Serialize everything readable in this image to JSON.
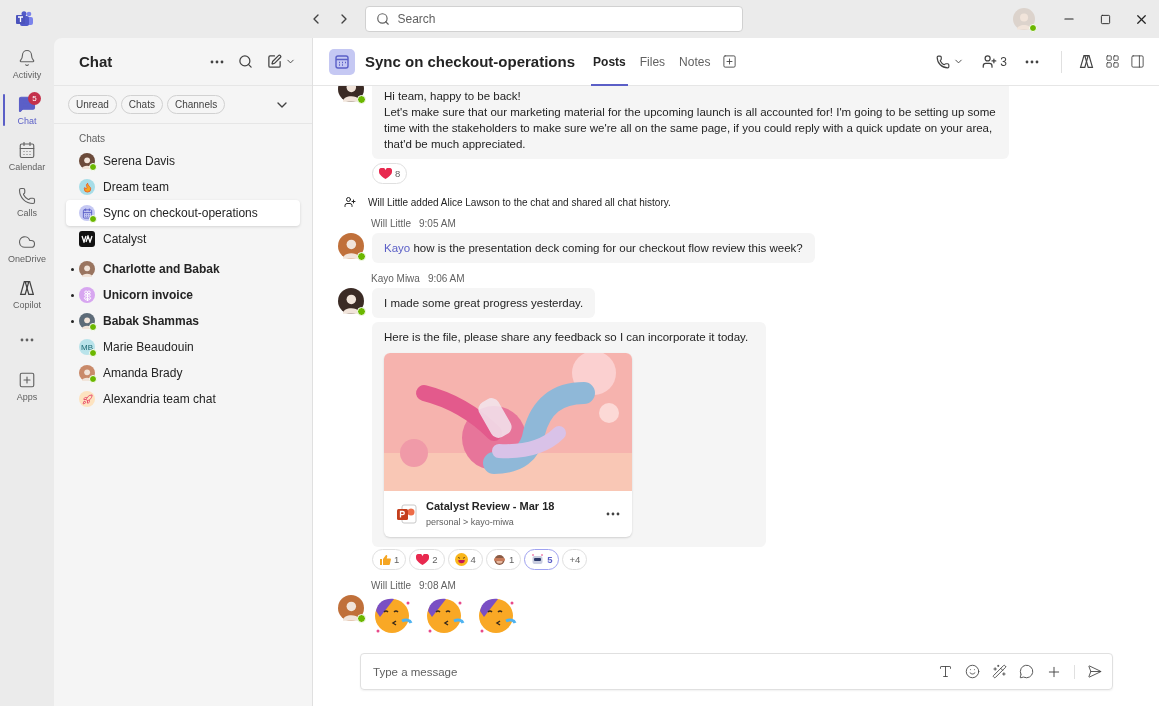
{
  "titlebar": {
    "search_placeholder": "Search"
  },
  "rail": [
    {
      "kind": "activity",
      "label": "Activity",
      "selected": false
    },
    {
      "kind": "chat",
      "label": "Chat",
      "selected": true,
      "badge": "5"
    },
    {
      "kind": "calendar",
      "label": "Calendar",
      "selected": false
    },
    {
      "kind": "calls",
      "label": "Calls",
      "selected": false
    },
    {
      "kind": "onedrive",
      "label": "OneDrive",
      "selected": false
    },
    {
      "kind": "copilot",
      "label": "Copilot",
      "selected": false
    },
    {
      "kind": "more",
      "selected": false
    },
    {
      "kind": "apps",
      "label": "Apps",
      "selected": false
    }
  ],
  "chat_panel": {
    "title": "Chat",
    "filters": [
      "Unread",
      "Chats",
      "Channels"
    ],
    "section": "Chats",
    "items": [
      {
        "name": "Serena Davis",
        "kind": "person",
        "color": "#6b4a3a",
        "available": true,
        "unread": false,
        "selected": false
      },
      {
        "name": "Dream team",
        "kind": "flame",
        "color": "#a7dde8",
        "available": false,
        "unread": false,
        "selected": false
      },
      {
        "name": "Sync on checkout-operations",
        "kind": "calendar",
        "color": "#c5c8f3",
        "available": true,
        "unread": false,
        "selected": true
      },
      {
        "name": "Catalyst",
        "kind": "logo",
        "color": "#111111",
        "available": false,
        "unread": false,
        "selected": false
      },
      {
        "name": "Charlotte and Babak",
        "kind": "person",
        "color": "#9a7560",
        "available": false,
        "unread": true,
        "selected": false
      },
      {
        "name": "Unicorn invoice",
        "kind": "flower",
        "color": "#d7a6f0",
        "available": false,
        "unread": true,
        "selected": false
      },
      {
        "name": "Babak Shammas",
        "kind": "person",
        "color": "#5d6b78",
        "available": true,
        "unread": true,
        "selected": false
      },
      {
        "name": "Marie Beaudouin",
        "kind": "initials",
        "initials": "MB",
        "color": "#b9e3ea",
        "available": true,
        "unread": false,
        "selected": false
      },
      {
        "name": "Amanda Brady",
        "kind": "person",
        "color": "#c98a6a",
        "available": true,
        "unread": false,
        "selected": false
      },
      {
        "name": "Alexandria team chat",
        "kind": "rocket",
        "color": "#fde3c0",
        "available": false,
        "unread": false,
        "selected": false
      }
    ]
  },
  "header": {
    "title": "Sync on checkout-operations",
    "tabs": [
      {
        "label": "Posts",
        "selected": true
      },
      {
        "label": "Files",
        "selected": false
      },
      {
        "label": "Notes",
        "selected": false
      }
    ],
    "participants": "3"
  },
  "messages": [
    {
      "kind": "message",
      "color": "#3b2b25",
      "available": true,
      "lines": [
        "Hi team, happy to be back!",
        "Let's make sure that our marketing material for the upcoming launch is all accounted for! I'm going to be setting up some time with the stakeholders to make sure we're all on the same page, if you could reply with a quick update on your area, that'd be much appreciated."
      ],
      "reactions": [
        {
          "kind": "heart",
          "count": "8",
          "selected": false
        }
      ]
    },
    {
      "kind": "event",
      "text": "Will Little added Alice Lawson to the chat and shared all chat history."
    },
    {
      "kind": "message",
      "author": "Will Little",
      "time": "9:05 AM",
      "color": "#c0703a",
      "available": true,
      "mention": "Kayo",
      "text": "how is the presentation deck coming for our checkout flow review this week?"
    },
    {
      "kind": "message",
      "author": "Kayo Miwa",
      "time": "9:06 AM",
      "color": "#3b2b25",
      "available": true,
      "text": "I made some great progress yesterday."
    },
    {
      "kind": "file",
      "text": "Here is the file, please share any feedback so I can incorporate it today.",
      "file": {
        "name": "Catalyst Review - Mar 18",
        "path": "personal > kayo-miwa"
      },
      "reactions": [
        {
          "kind": "thumb",
          "count": "1",
          "selected": false
        },
        {
          "kind": "heart",
          "count": "2",
          "selected": false
        },
        {
          "kind": "laugh",
          "count": "4",
          "selected": false
        },
        {
          "kind": "monkey",
          "count": "1",
          "selected": false
        },
        {
          "kind": "robot",
          "count": "5",
          "selected": true
        }
      ],
      "more_reactions": "+4"
    },
    {
      "kind": "stickers",
      "author": "Will Little",
      "time": "9:08 AM",
      "color": "#c0703a",
      "available": true,
      "stickers": [
        {
          "kind": "party"
        },
        {
          "kind": "party"
        },
        {
          "kind": "party"
        }
      ]
    }
  ],
  "composer": {
    "placeholder": "Type a message"
  }
}
